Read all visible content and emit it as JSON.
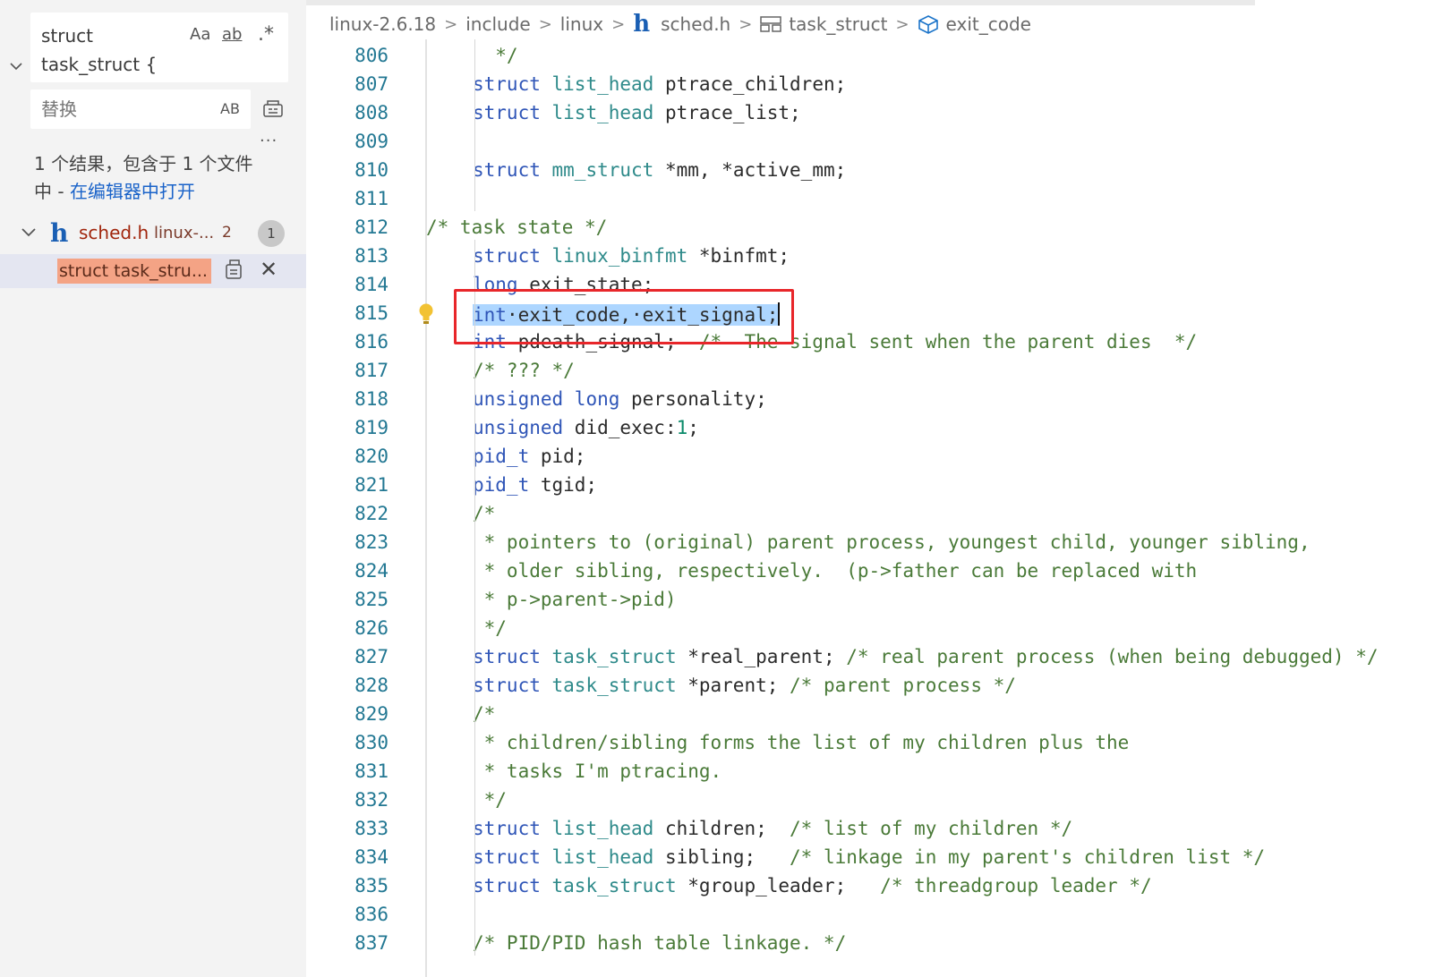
{
  "search": {
    "query": "struct\ntask_struct {",
    "match_case_label": "Aa",
    "whole_word_label": "ab",
    "regex_label": ".*",
    "replace_placeholder": "替换",
    "preserve_case_label": "AB",
    "more_label": "...",
    "summary_text": "1 个结果，包含于 1 个文件中 - ",
    "open_in_editor_link": "在编辑器中打开"
  },
  "results": {
    "file_name": "sched.h",
    "file_path": "linux-...",
    "file_match_count_text": "2",
    "file_badge_count": "1",
    "match_preview": "struct task_stru..."
  },
  "breadcrumb": {
    "items": [
      "linux-2.6.18",
      "include",
      "linux",
      "sched.h",
      "task_struct",
      "exit_code"
    ],
    "separator": ">"
  },
  "editor": {
    "line_numbers": [
      "806",
      "807",
      "808",
      "809",
      "810",
      "811",
      "812",
      "813",
      "814",
      "815",
      "816",
      "817",
      "818",
      "819",
      "820",
      "821",
      "822",
      "823",
      "824",
      "825",
      "826",
      "827",
      "828",
      "829",
      "830",
      "831",
      "832",
      "833",
      "834",
      "835",
      "836",
      "837"
    ],
    "lines": [
      [
        {
          "t": "  */",
          "c": "cm"
        }
      ],
      [
        {
          "t": "struct ",
          "c": "kw"
        },
        {
          "t": "list_head",
          "c": "type"
        },
        {
          "t": " ptrace_children;",
          "c": ""
        }
      ],
      [
        {
          "t": "struct ",
          "c": "kw"
        },
        {
          "t": "list_head",
          "c": "type"
        },
        {
          "t": " ptrace_list;",
          "c": ""
        }
      ],
      [],
      [
        {
          "t": "struct ",
          "c": "kw"
        },
        {
          "t": "mm_struct",
          "c": "type"
        },
        {
          "t": " *mm, *active_mm;",
          "c": ""
        }
      ],
      [],
      [
        {
          "t": "/* task state */",
          "c": "cm"
        }
      ],
      [
        {
          "t": "struct ",
          "c": "kw"
        },
        {
          "t": "linux_binfmt",
          "c": "type"
        },
        {
          "t": " *binfmt;",
          "c": ""
        }
      ],
      [
        {
          "t": "long",
          "c": "kw"
        },
        {
          "t": " exit_state;",
          "c": ""
        }
      ],
      [
        {
          "t": "int",
          "c": "kw sel"
        },
        {
          "t": "·exit_code,·exit_signal;",
          "c": "sel"
        }
      ],
      [
        {
          "t": "int",
          "c": "kw"
        },
        {
          "t": " pdeath_signal;  ",
          "c": ""
        },
        {
          "t": "/*  The signal sent when the parent dies  */",
          "c": "cm"
        }
      ],
      [
        {
          "t": "/* ??? */",
          "c": "cm"
        }
      ],
      [
        {
          "t": "unsigned ",
          "c": "kw"
        },
        {
          "t": "long",
          "c": "kw"
        },
        {
          "t": " personality;",
          "c": ""
        }
      ],
      [
        {
          "t": "unsigned",
          "c": "kw"
        },
        {
          "t": " did_exec:",
          "c": ""
        },
        {
          "t": "1",
          "c": "num"
        },
        {
          "t": ";",
          "c": ""
        }
      ],
      [
        {
          "t": "pid_t",
          "c": "kw"
        },
        {
          "t": " pid;",
          "c": ""
        }
      ],
      [
        {
          "t": "pid_t",
          "c": "kw"
        },
        {
          "t": " tgid;",
          "c": ""
        }
      ],
      [
        {
          "t": "/*",
          "c": "cm"
        }
      ],
      [
        {
          "t": " * pointers to (original) parent process, youngest child, younger sibling,",
          "c": "cm"
        }
      ],
      [
        {
          "t": " * older sibling, respectively.  (p->father can be replaced with",
          "c": "cm"
        }
      ],
      [
        {
          "t": " * p->parent->pid)",
          "c": "cm"
        }
      ],
      [
        {
          "t": " */",
          "c": "cm"
        }
      ],
      [
        {
          "t": "struct ",
          "c": "kw"
        },
        {
          "t": "task_struct",
          "c": "type"
        },
        {
          "t": " *real_parent; ",
          "c": ""
        },
        {
          "t": "/* real parent process (when being debugged) */",
          "c": "cm"
        }
      ],
      [
        {
          "t": "struct ",
          "c": "kw"
        },
        {
          "t": "task_struct",
          "c": "type"
        },
        {
          "t": " *parent; ",
          "c": ""
        },
        {
          "t": "/* parent process */",
          "c": "cm"
        }
      ],
      [
        {
          "t": "/*",
          "c": "cm"
        }
      ],
      [
        {
          "t": " * children/sibling forms the list of my children plus the",
          "c": "cm"
        }
      ],
      [
        {
          "t": " * tasks I'm ptracing.",
          "c": "cm"
        }
      ],
      [
        {
          "t": " */",
          "c": "cm"
        }
      ],
      [
        {
          "t": "struct ",
          "c": "kw"
        },
        {
          "t": "list_head",
          "c": "type"
        },
        {
          "t": " children;  ",
          "c": ""
        },
        {
          "t": "/* list of my children */",
          "c": "cm"
        }
      ],
      [
        {
          "t": "struct ",
          "c": "kw"
        },
        {
          "t": "list_head",
          "c": "type"
        },
        {
          "t": " sibling;   ",
          "c": ""
        },
        {
          "t": "/* linkage in my parent's children list */",
          "c": "cm"
        }
      ],
      [
        {
          "t": "struct ",
          "c": "kw"
        },
        {
          "t": "task_struct",
          "c": "type"
        },
        {
          "t": " *group_leader;   ",
          "c": ""
        },
        {
          "t": "/* threadgroup leader */",
          "c": "cm"
        }
      ],
      [],
      [
        {
          "t": "/* PID/PID hash table linkage. */",
          "c": "cm"
        }
      ]
    ]
  }
}
